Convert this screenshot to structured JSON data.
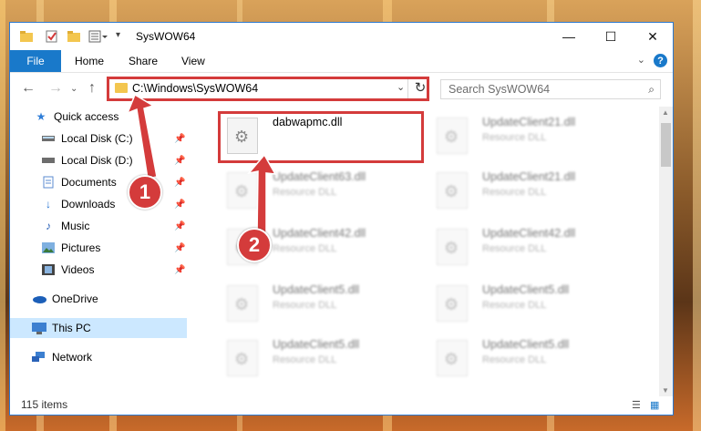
{
  "window": {
    "title": "SysWOW64",
    "controls": {
      "minimize": "—",
      "maximize": "☐",
      "close": "✕"
    }
  },
  "ribbon": {
    "file": "File",
    "tabs": [
      "Home",
      "Share",
      "View"
    ]
  },
  "address": {
    "path": "C:\\Windows\\SysWOW64",
    "search_placeholder": "Search SysWOW64"
  },
  "sidebar": {
    "items": [
      {
        "label": "Quick access",
        "icon": "star-icon",
        "pinned": false
      },
      {
        "label": "Local Disk (C:)",
        "icon": "drive-icon",
        "pinned": true
      },
      {
        "label": "Local Disk (D:)",
        "icon": "drive-icon",
        "pinned": true
      },
      {
        "label": "Documents",
        "icon": "document-icon",
        "pinned": true
      },
      {
        "label": "Downloads",
        "icon": "download-icon",
        "pinned": true
      },
      {
        "label": "Music",
        "icon": "music-icon",
        "pinned": true
      },
      {
        "label": "Pictures",
        "icon": "pictures-icon",
        "pinned": true
      },
      {
        "label": "Videos",
        "icon": "videos-icon",
        "pinned": true
      },
      {
        "label": "OneDrive",
        "icon": "cloud-icon",
        "pinned": false
      },
      {
        "label": "This PC",
        "icon": "computer-icon",
        "pinned": false,
        "selected": true
      },
      {
        "label": "Network",
        "icon": "network-icon",
        "pinned": false
      }
    ]
  },
  "files": [
    {
      "name": "dabwapmc.dll",
      "type": "",
      "highlighted": true
    },
    {
      "name": "UpdateClient21.dll",
      "type": "Resource DLL"
    },
    {
      "name": "UpdateClient63.dll",
      "type": "Resource DLL"
    },
    {
      "name": "UpdateClient21.dll",
      "type": "Resource DLL"
    },
    {
      "name": "UpdateClient42.dll",
      "type": "Resource DLL"
    },
    {
      "name": "UpdateClient42.dll",
      "type": "Resource DLL"
    },
    {
      "name": "UpdateClient5.dll",
      "type": "Resource DLL"
    },
    {
      "name": "UpdateClient5.dll",
      "type": "Resource DLL"
    },
    {
      "name": "UpdateClient5.dll",
      "type": "Resource DLL"
    },
    {
      "name": "UpdateClient5.dll",
      "type": "Resource DLL"
    }
  ],
  "status": {
    "item_count": "115 items"
  },
  "annotations": {
    "step1": "1",
    "step2": "2",
    "color": "#d43b3b"
  }
}
